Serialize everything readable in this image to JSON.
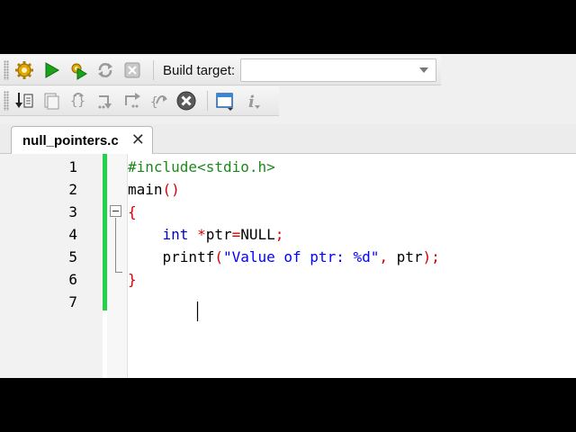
{
  "toolbar": {
    "build_target_label": "Build target:",
    "build_target_value": "",
    "row1_icons": [
      "build-gear-icon",
      "run-icon",
      "build-run-icon",
      "rebuild-icon",
      "abort-icon"
    ],
    "row2_icons": [
      "debug-run-to-cursor-icon",
      "debug-step-icon",
      "debug-next-line-icon",
      "debug-step-into-icon",
      "debug-step-out-icon",
      "debug-next-instruction-icon",
      "debug-stop-icon",
      "debug-windows-icon",
      "debug-info-icon"
    ]
  },
  "tabs": [
    {
      "label": "null_pointers.c",
      "close": "✕"
    }
  ],
  "editor": {
    "lines": [
      {
        "num": "1",
        "segments": [
          {
            "t": "#include<stdio.h>",
            "c": "c-pre"
          }
        ]
      },
      {
        "num": "2",
        "segments": [
          {
            "t": "main",
            "c": ""
          },
          {
            "t": "()",
            "c": "c-op"
          }
        ]
      },
      {
        "num": "3",
        "segments": [
          {
            "t": "{",
            "c": "c-brace"
          }
        ]
      },
      {
        "num": "4",
        "segments": [
          {
            "t": "    ",
            "c": ""
          },
          {
            "t": "int",
            "c": "c-kw"
          },
          {
            "t": " ",
            "c": ""
          },
          {
            "t": "*",
            "c": "c-op"
          },
          {
            "t": "ptr",
            "c": ""
          },
          {
            "t": "=",
            "c": "c-op"
          },
          {
            "t": "NULL",
            "c": ""
          },
          {
            "t": ";",
            "c": "c-op"
          }
        ]
      },
      {
        "num": "5",
        "segments": [
          {
            "t": "    ",
            "c": ""
          },
          {
            "t": "printf",
            "c": ""
          },
          {
            "t": "(",
            "c": "c-op"
          },
          {
            "t": "\"Value of ptr: %d\"",
            "c": "c-str"
          },
          {
            "t": ", ",
            "c": "c-op"
          },
          {
            "t": "ptr",
            "c": ""
          },
          {
            "t": ");",
            "c": "c-op"
          }
        ]
      },
      {
        "num": "6",
        "segments": [
          {
            "t": "}",
            "c": "c-brace"
          }
        ]
      },
      {
        "num": "7",
        "segments": []
      }
    ]
  },
  "colors": {
    "change_bar": "#22d24a",
    "preprocessor": "#1b8a1b",
    "keyword": "#0000cc",
    "string": "#0000ff",
    "operator": "#d40000"
  }
}
